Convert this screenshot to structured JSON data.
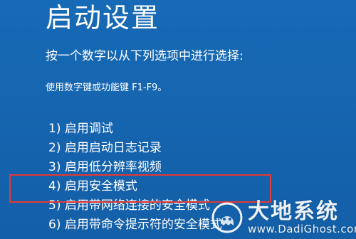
{
  "screen": {
    "title": "启动设置",
    "prompt": "按一个数字以从下列选项中进行选择:",
    "hint": "使用数字键或功能键 F1-F9。",
    "highlight_color": "#e53935",
    "background_color": "#1565b0"
  },
  "options": [
    {
      "label": "1) 启用调试"
    },
    {
      "label": "2) 启用启动日志记录"
    },
    {
      "label": "3) 启用低分辨率视频"
    },
    {
      "label": "4) 启用安全模式"
    },
    {
      "label": "5) 启用带网络连接的安全模式"
    },
    {
      "label": "6) 启用带命令提示符的安全模式"
    }
  ],
  "watermark": {
    "name": "大地系统",
    "domain": "www.DadiGhost.com"
  }
}
